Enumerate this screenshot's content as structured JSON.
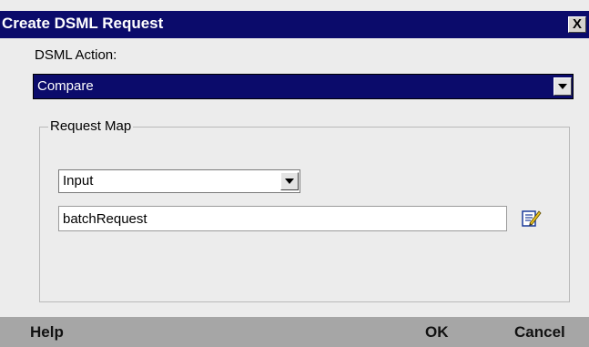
{
  "dialog": {
    "title": "Create DSML Request",
    "close_label": "X"
  },
  "dsml_action": {
    "label": "DSML Action:",
    "selected": "Compare"
  },
  "request_map": {
    "title": "Request Map",
    "mode_selected": "Input",
    "request_value": "batchRequest",
    "edit_icon": "edit-pencil-icon"
  },
  "footer": {
    "help_label": "Help",
    "ok_label": "OK",
    "cancel_label": "Cancel"
  },
  "colors": {
    "titlebar": "#0b0b6b",
    "selection": "#0b0b6b",
    "body": "#ececec",
    "footer": "#a6a6a6"
  }
}
